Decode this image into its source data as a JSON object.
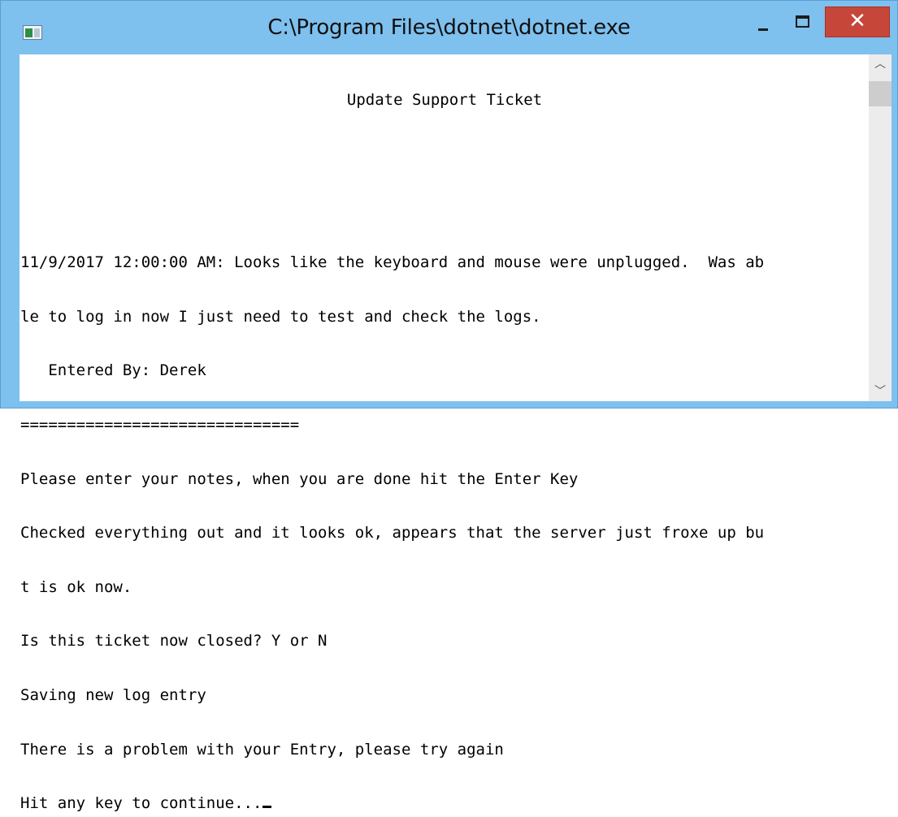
{
  "window": {
    "title": "C:\\Program Files\\dotnet\\dotnet.exe",
    "controls": {
      "minimize_label": "",
      "maximize_label": "",
      "close_label": "✕"
    },
    "accent_color": "#7ec0ee",
    "close_color": "#c7463a"
  },
  "console": {
    "lines": [
      "Update Support Ticket",
      "",
      "",
      "11/9/2017 12:00:00 AM: Looks like the keyboard and mouse were unplugged.  Was ab",
      "le to log in now I just need to test and check the logs.",
      "   Entered By: Derek",
      "==============================",
      "Please enter your notes, when you are done hit the Enter Key",
      "Checked everything out and it looks ok, appears that the server just froxe up bu",
      "t is ok now.",
      "Is this ticket now closed? Y or N",
      "Saving new log entry",
      "There is a problem with your Entry, please try again",
      "Hit any key to continue..."
    ]
  },
  "scrollbar": {
    "up_icon": "chevron-up-icon",
    "down_icon": "chevron-down-icon",
    "up_glyph": "︿",
    "down_glyph": "﹀"
  }
}
